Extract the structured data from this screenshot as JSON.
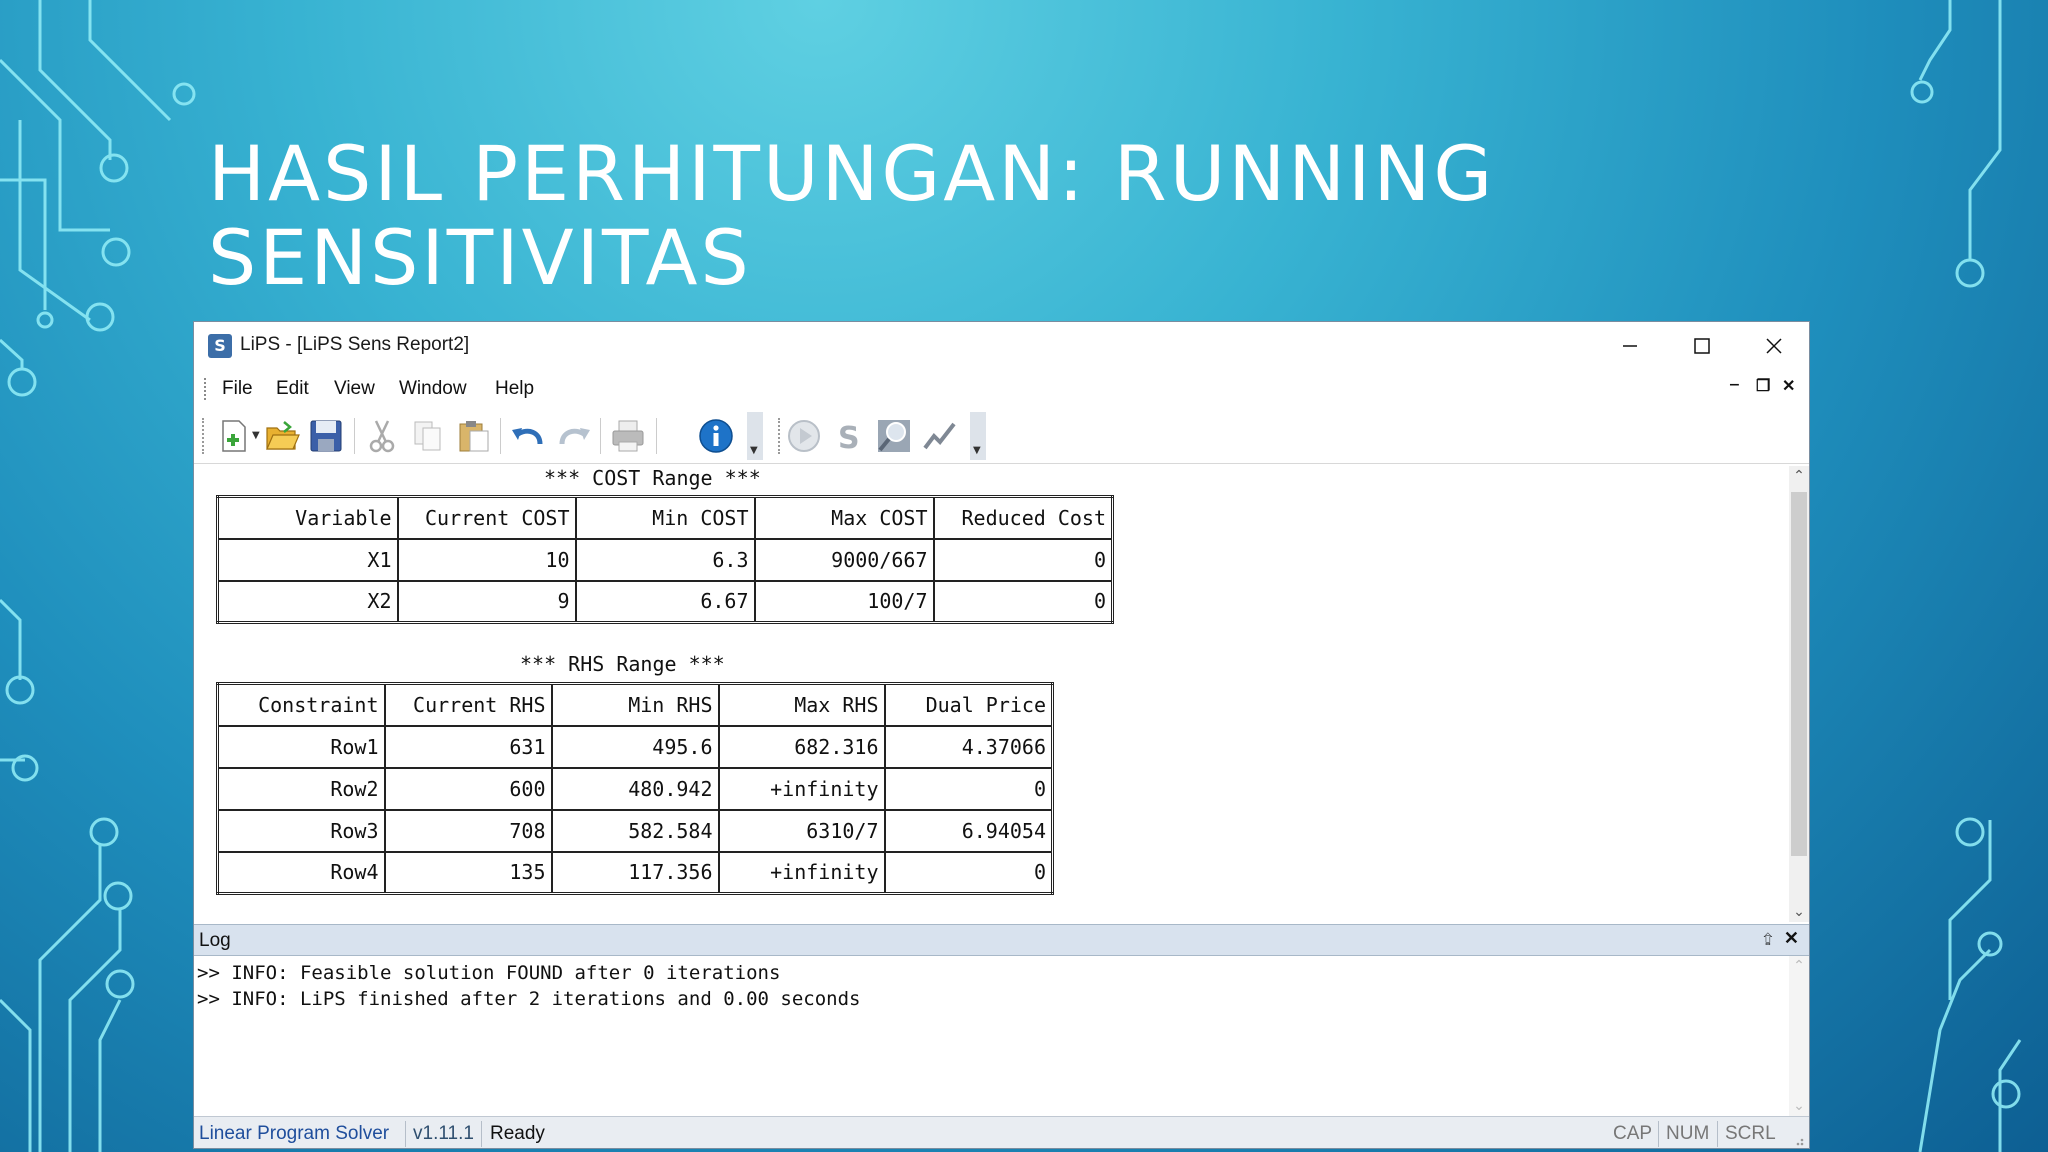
{
  "slide": {
    "title_line1": "HASIL PERHITUNGAN: RUNNING",
    "title_line2": "SENSITIVITAS"
  },
  "window": {
    "title": "LiPS - [LiPS Sens Report2]",
    "app_icon_glyph": "S",
    "controls": {
      "minimize": "minimize-icon",
      "maximize": "maximize-icon",
      "close": "close-icon"
    }
  },
  "menu": {
    "items": [
      "File",
      "Edit",
      "View",
      "Window",
      "Help"
    ],
    "mdi_minimize": "‒",
    "mdi_restore": "❐",
    "mdi_close": "✕"
  },
  "toolbar": {
    "buttons": [
      "new-icon",
      "open-folder-icon",
      "save-icon",
      "cut-icon",
      "copy-icon",
      "paste-icon",
      "undo-icon",
      "redo-icon",
      "print-icon",
      "info-icon",
      "run-icon",
      "solve-icon",
      "zoom-icon",
      "chart-icon"
    ]
  },
  "report": {
    "cost_heading": "*** COST Range ***",
    "cost_columns": [
      "Variable",
      "Current COST",
      "Min COST",
      "Max COST",
      "Reduced Cost"
    ],
    "cost_rows": [
      [
        "X1",
        "10",
        "6.3",
        "9000/667",
        "0"
      ],
      [
        "X2",
        "9",
        "6.67",
        "100/7",
        "0"
      ]
    ],
    "rhs_heading": "*** RHS Range ***",
    "rhs_columns": [
      "Constraint",
      "Current RHS",
      "Min RHS",
      "Max RHS",
      "Dual Price"
    ],
    "rhs_rows": [
      [
        "Row1",
        "631",
        "495.6",
        "682.316",
        "4.37066"
      ],
      [
        "Row2",
        "600",
        "480.942",
        "+infinity",
        "0"
      ],
      [
        "Row3",
        "708",
        "582.584",
        "6310/7",
        "6.94054"
      ],
      [
        "Row4",
        "135",
        "117.356",
        "+infinity",
        "0"
      ]
    ]
  },
  "log": {
    "title": "Log",
    "pin_glyph": "⮸",
    "close_glyph": "✕",
    "lines": [
      ">> INFO: Feasible solution FOUND after 0 iterations",
      ">> INFO: LiPS finished after 2 iterations and 0.00 seconds"
    ]
  },
  "status": {
    "app_name": "Linear Program Solver",
    "version": "v1.11.1",
    "state": "Ready",
    "cap": "CAP",
    "num": "NUM",
    "scrl": "SCRL"
  },
  "colors": {
    "status_accent": "#1f4e9c",
    "version_color": "#2f4f6f",
    "info_blue": "#1e73c8"
  }
}
